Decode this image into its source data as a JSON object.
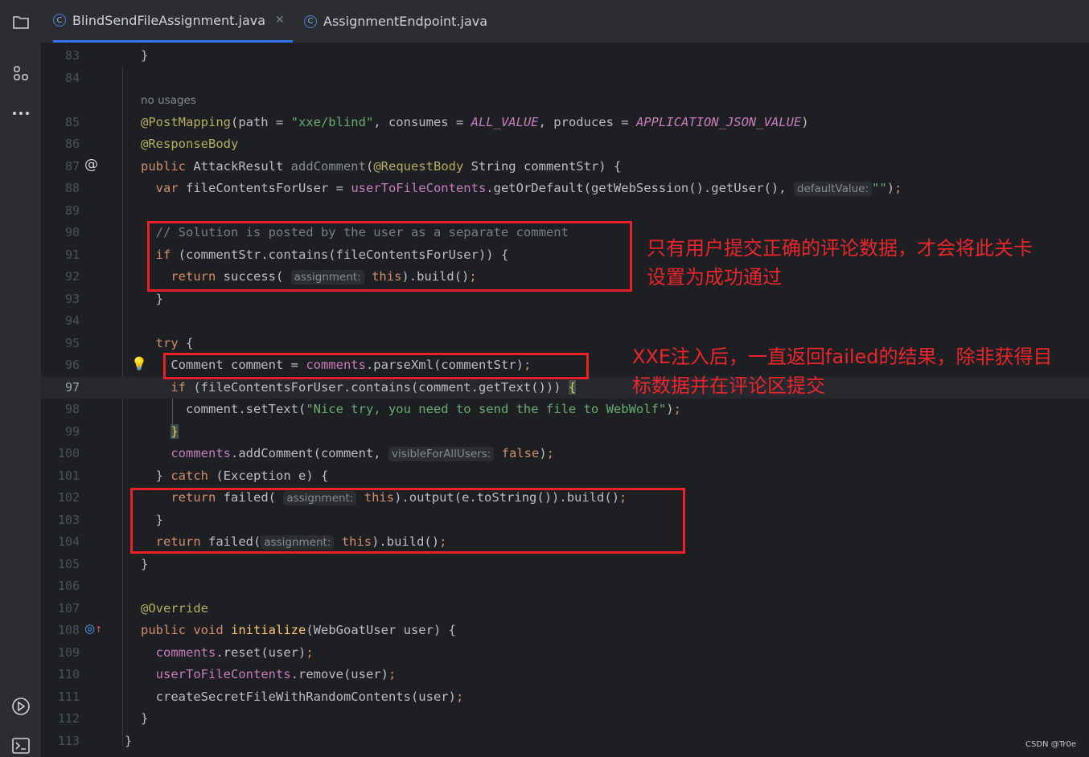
{
  "tabs": [
    {
      "label": "BlindSendFileAssignment.java",
      "active": true
    },
    {
      "label": "AssignmentEndpoint.java",
      "active": false
    }
  ],
  "hints": {
    "no_usages": "no usages",
    "default_value": "defaultValue:",
    "assignment": "assignment:",
    "visible_for_all": "visibleForAllUsers:"
  },
  "lines": [
    "83",
    "84",
    "85",
    "86",
    "87",
    "88",
    "89",
    "90",
    "91",
    "92",
    "93",
    "94",
    "95",
    "96",
    "97",
    "98",
    "99",
    "100",
    "101",
    "102",
    "103",
    "104",
    "105",
    "106",
    "107",
    "108",
    "109",
    "110",
    "111",
    "112",
    "113"
  ],
  "annotations": {
    "note1_line1": "只有用户提交正确的评论数据，才会将此关卡",
    "note1_line2": "设置为成功通过",
    "note2_line1": "XXE注入后，一直返回failed的结果，除非获得目",
    "note2_line2": "标数据并在评论区提交"
  },
  "watermark": "CSDN @Tr0e",
  "colors": {
    "keyword": "#cf8e6d",
    "annotation": "#b3ae60",
    "string": "#6aab73",
    "field": "#c77dbb",
    "redbox": "#e8212a"
  }
}
